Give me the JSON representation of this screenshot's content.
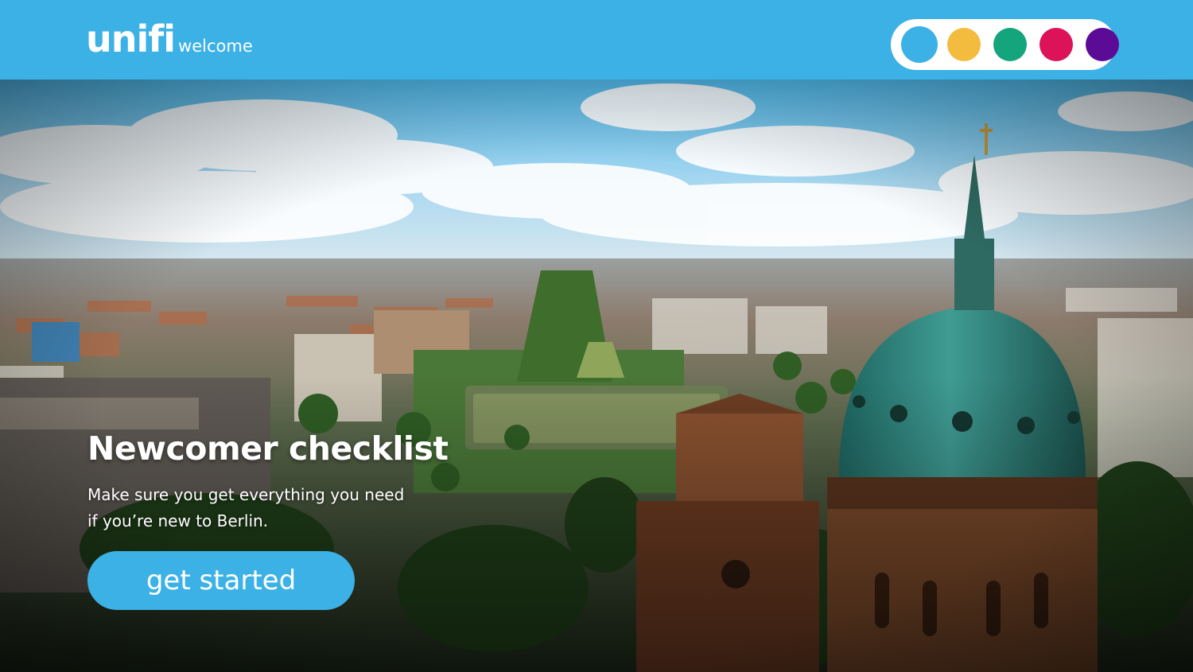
{
  "header": {
    "brand": "unifi",
    "brand_sub": "welcome"
  },
  "theme_picker": {
    "colors": [
      {
        "name": "blue",
        "hex": "#3cb1e6",
        "selected": true
      },
      {
        "name": "yellow",
        "hex": "#f3bc3f",
        "selected": false
      },
      {
        "name": "green",
        "hex": "#14a57d",
        "selected": false
      },
      {
        "name": "pink",
        "hex": "#dc1359",
        "selected": false
      },
      {
        "name": "purple",
        "hex": "#5c0b96",
        "selected": false
      }
    ]
  },
  "hero": {
    "title": "Newcomer checklist",
    "subtitle_line1": "Make sure you get everything you need",
    "subtitle_line2": "if you’re new to Berlin.",
    "cta_label": "get started"
  },
  "colors": {
    "accent": "#3cb1e6"
  }
}
